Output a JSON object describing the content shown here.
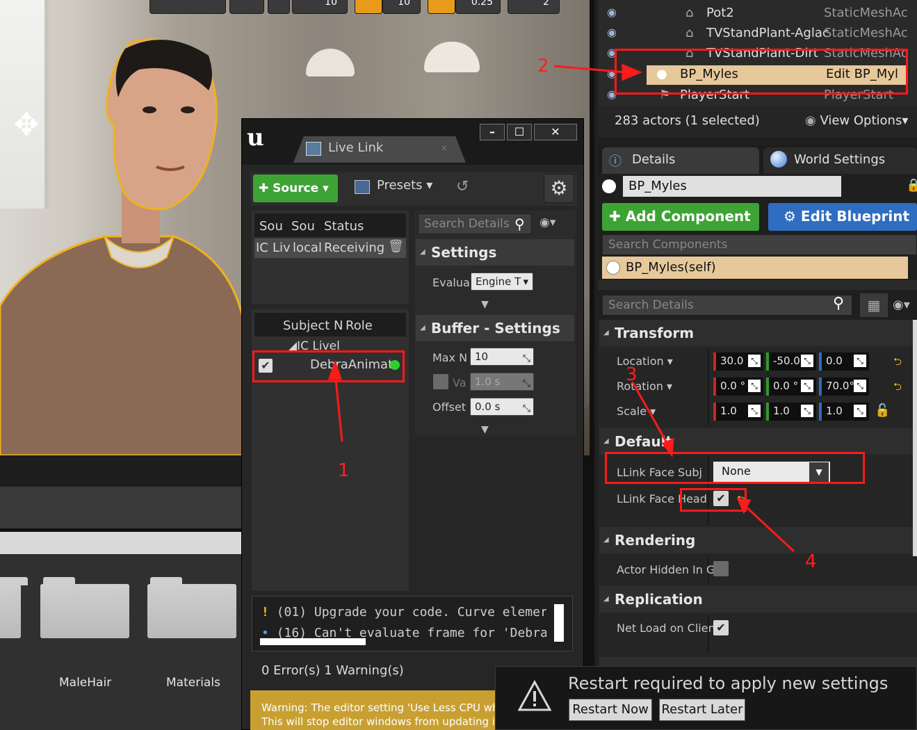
{
  "viewport": {
    "toolbar_values": [
      "10",
      "10",
      "0.25",
      "2"
    ]
  },
  "content_browser": {
    "folders": [
      {
        "label": "MaleHair"
      },
      {
        "label": "Materials"
      }
    ]
  },
  "live_link": {
    "logo": "u",
    "tab_title": "Live Link",
    "source_button": "Source",
    "presets_button": "Presets",
    "sources_table": {
      "headers": [
        "Sou",
        "Sou",
        "Status"
      ],
      "row": {
        "type_icon": "IC",
        "name": "Liv",
        "machine": "local",
        "status": "Receiving"
      }
    },
    "subjects_table": {
      "headers": [
        "Subject N",
        "Role"
      ],
      "group": "IC Livel",
      "subject": {
        "name": "DebraAnimat",
        "checked": true,
        "status_color": "#2ccf2c"
      }
    },
    "details": {
      "search_placeholder": "Search Details",
      "settings_section": "Settings",
      "evaluate_label": "Evalua",
      "evaluate_value": "Engine T",
      "buffer_section": "Buffer - Settings",
      "max_label": "Max N",
      "max_value": "10",
      "valid_label": "Va",
      "valid_value": "1.0 s",
      "offset_label": "Offset",
      "offset_value": "0.0 s"
    },
    "log": {
      "line1": "(01) Upgrade your code. Curve elemer",
      "line2": "(16) Can't evaluate frame for 'Debra"
    },
    "status": "0 Error(s)  1 Warning(s)",
    "warning_line1": "Warning: The editor setting 'Use Less CPU whe",
    "warning_line2": "This will stop editor windows from updating in r"
  },
  "outliner": {
    "rows": [
      {
        "name": "Pot2",
        "type": "StaticMeshAc"
      },
      {
        "name": "TVStandPlant-Aglac",
        "type": "StaticMeshAc"
      },
      {
        "name": "TVStandPlant-Dirt",
        "type": "StaticMeshAc"
      },
      {
        "name": "BP_Myles",
        "type": "Edit BP_Myl"
      },
      {
        "name": "PlayerStart",
        "type": "PlayerStart"
      }
    ],
    "footer": "283 actors (1 selected)",
    "view_options": "View Options"
  },
  "details": {
    "tab_details": "Details",
    "tab_world": "World Settings",
    "actor_name": "BP_Myles",
    "add_component": "Add Component",
    "edit_blueprint": "Edit Blueprint",
    "search_components_placeholder": "Search Components",
    "component_self": "BP_Myles(self)",
    "search_details_placeholder": "Search Details",
    "transform": {
      "title": "Transform",
      "location_label": "Location",
      "location": [
        "30.0",
        "-50.0",
        "0.0"
      ],
      "rotation_label": "Rotation",
      "rotation": [
        "0.0 °",
        "0.0 °",
        "70.0°"
      ],
      "scale_label": "Scale",
      "scale": [
        "1.0",
        "1.0",
        "1.0"
      ]
    },
    "default": {
      "title": "Default",
      "face_subj_label": "LLink Face Subj",
      "face_subj_value": "None",
      "face_head_label": "LLink Face Head",
      "face_head_checked": true
    },
    "rendering": {
      "title": "Rendering",
      "hidden_label": "Actor Hidden In Ga"
    },
    "replication": {
      "title": "Replication",
      "net_load_label": "Net Load on Client"
    }
  },
  "restart_toast": {
    "message": "Restart required to apply new settings",
    "restart_now": "Restart Now",
    "restart_later": "Restart Later"
  },
  "annotations": [
    "1",
    "2",
    "3",
    "4"
  ],
  "colors": {
    "annotation_red": "#ff1a1a",
    "selection_tan": "#e6c89a",
    "green_button": "#3ea335",
    "blue_button": "#2f6dc0",
    "warning_bar": "#c8a032"
  }
}
